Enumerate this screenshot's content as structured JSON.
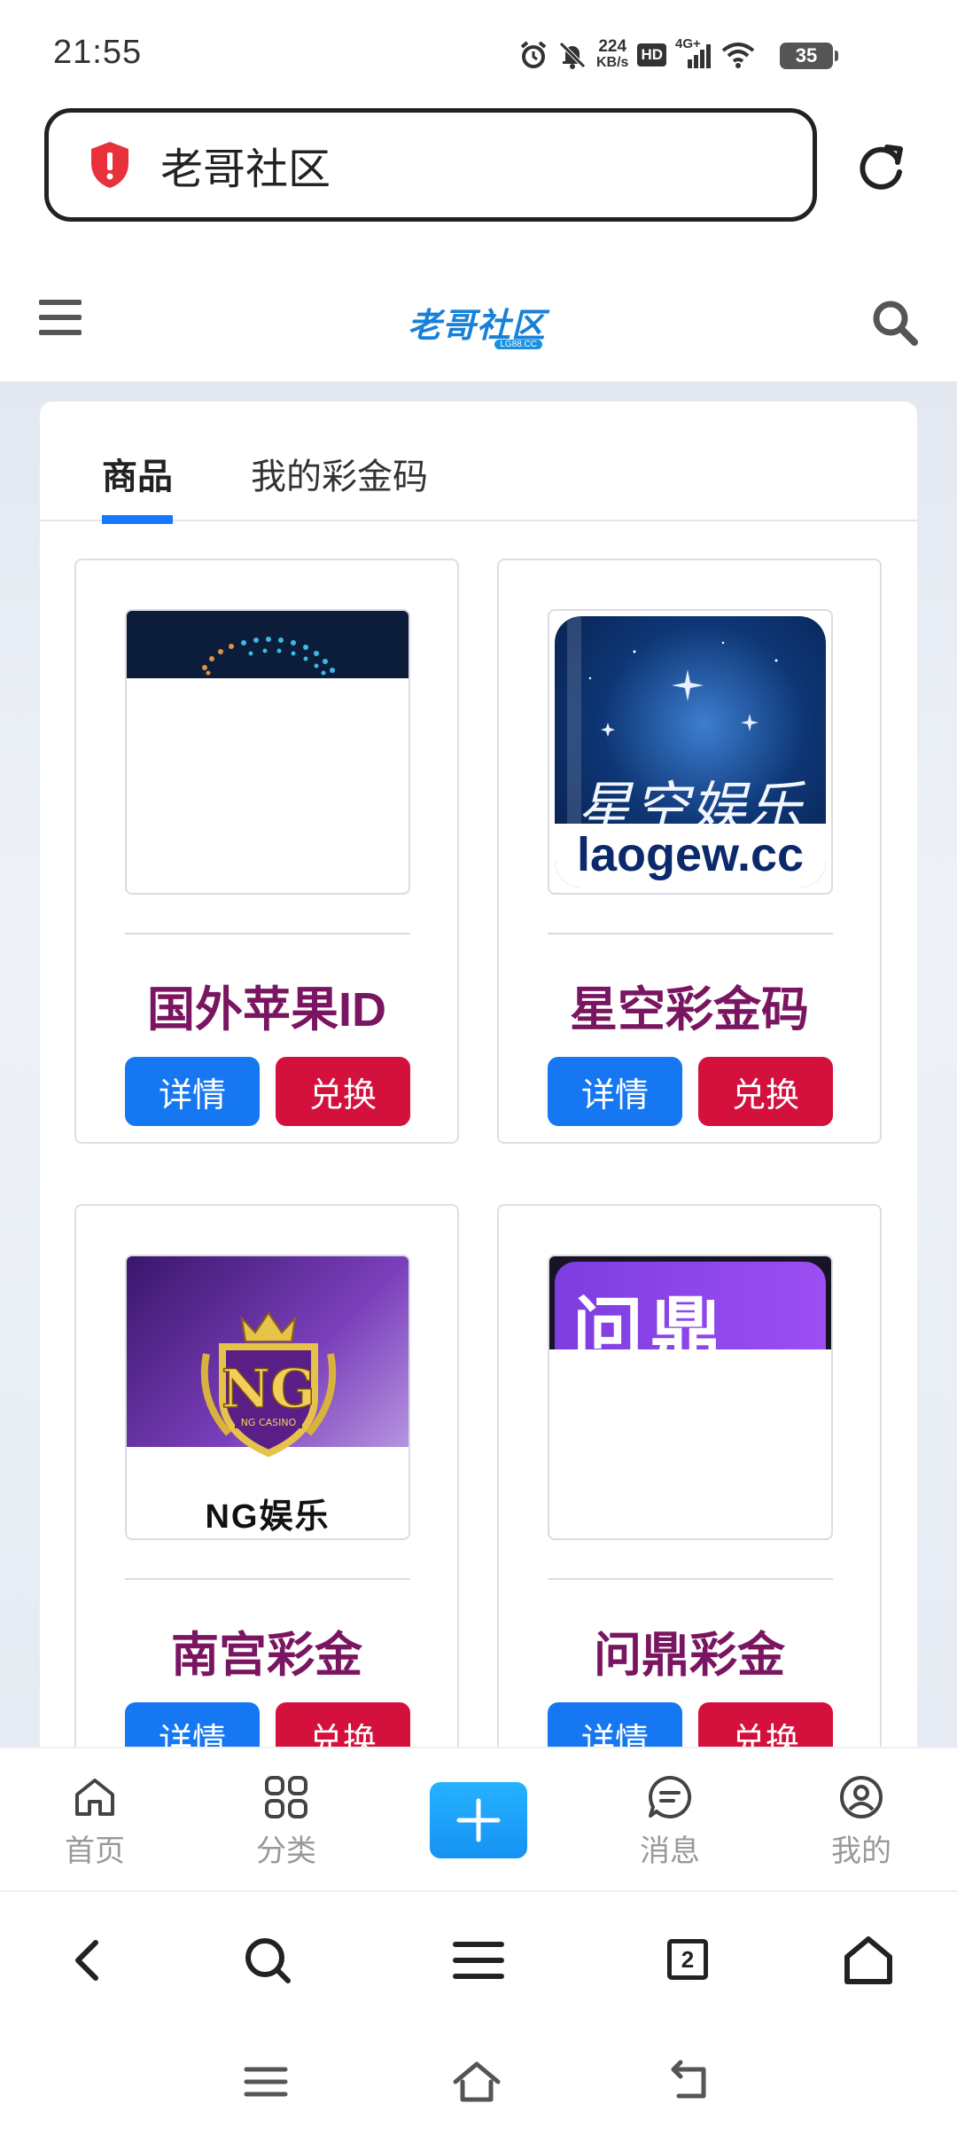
{
  "status_bar": {
    "time": "21:55",
    "net_speed_value": "224",
    "net_speed_unit": "KB/s",
    "hd_label": "HD",
    "signal_label": "4G+",
    "battery": "35"
  },
  "browser": {
    "address_text": "老哥社区"
  },
  "site": {
    "logo_text": "老哥社区",
    "logo_sub": "LG88.CC"
  },
  "tabs": [
    {
      "label": "商品"
    },
    {
      "label": "我的彩金码"
    }
  ],
  "products": [
    {
      "title": "国外苹果ID",
      "detail_label": "详情",
      "redeem_label": "兑换"
    },
    {
      "title": "星空彩金码",
      "detail_label": "详情",
      "redeem_label": "兑换",
      "image_script": "星空娱乐",
      "image_domain": "laogew.cc"
    },
    {
      "title": "南宫彩金",
      "detail_label": "详情",
      "redeem_label": "兑换",
      "image_badge": "NG",
      "image_badge_sub": "NG CASINO",
      "image_label": "NG娱乐"
    },
    {
      "title": "问鼎彩金",
      "detail_label": "详情",
      "redeem_label": "兑换",
      "image_top_text": "问鼎"
    }
  ],
  "site_nav": [
    {
      "label": "首页",
      "icon": "home-icon"
    },
    {
      "label": "分类",
      "icon": "grid-icon"
    },
    {
      "label": "",
      "icon": "plus-icon"
    },
    {
      "label": "消息",
      "icon": "message-icon"
    },
    {
      "label": "我的",
      "icon": "user-icon"
    }
  ],
  "browser_toolbar": {
    "tab_count": "2"
  },
  "colors": {
    "accent_blue": "#1677f2",
    "redeem_red": "#d4103d",
    "title_purple": "#7a1561",
    "plus_gradient": "#1592f3"
  }
}
